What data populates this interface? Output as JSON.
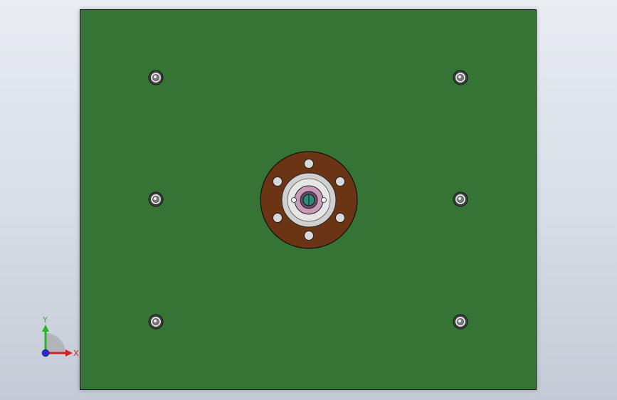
{
  "colors": {
    "plate": "#357434",
    "flange": "#6b3414",
    "hub": "#c9c9c9",
    "bore": "#c89bb8",
    "shaft": "#2e8c78",
    "x_axis": "#d42020",
    "y_axis": "#2ab42a",
    "z_axis": "#2a2ad4"
  },
  "triad": {
    "x_label": "X",
    "y_label": "Y"
  },
  "icons": {
    "screw": "countersunk-screw-icon",
    "flange": "bearing-flange-icon",
    "triad": "coordinate-triad-icon"
  }
}
